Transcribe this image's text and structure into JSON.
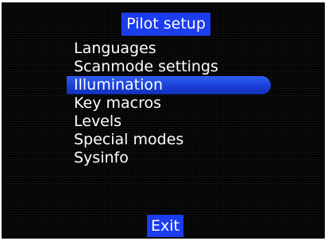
{
  "header": {
    "title": "Pilot setup"
  },
  "menu": {
    "selected_index": 2,
    "items": [
      {
        "label": "Languages"
      },
      {
        "label": "Scanmode settings"
      },
      {
        "label": "Illumination"
      },
      {
        "label": "Key macros"
      },
      {
        "label": "Levels"
      },
      {
        "label": "Special modes"
      },
      {
        "label": "Sysinfo"
      }
    ]
  },
  "footer": {
    "exit_label": "Exit"
  },
  "colors": {
    "background": "#000000",
    "accent": "#1c3dee",
    "text": "#ffffff"
  }
}
